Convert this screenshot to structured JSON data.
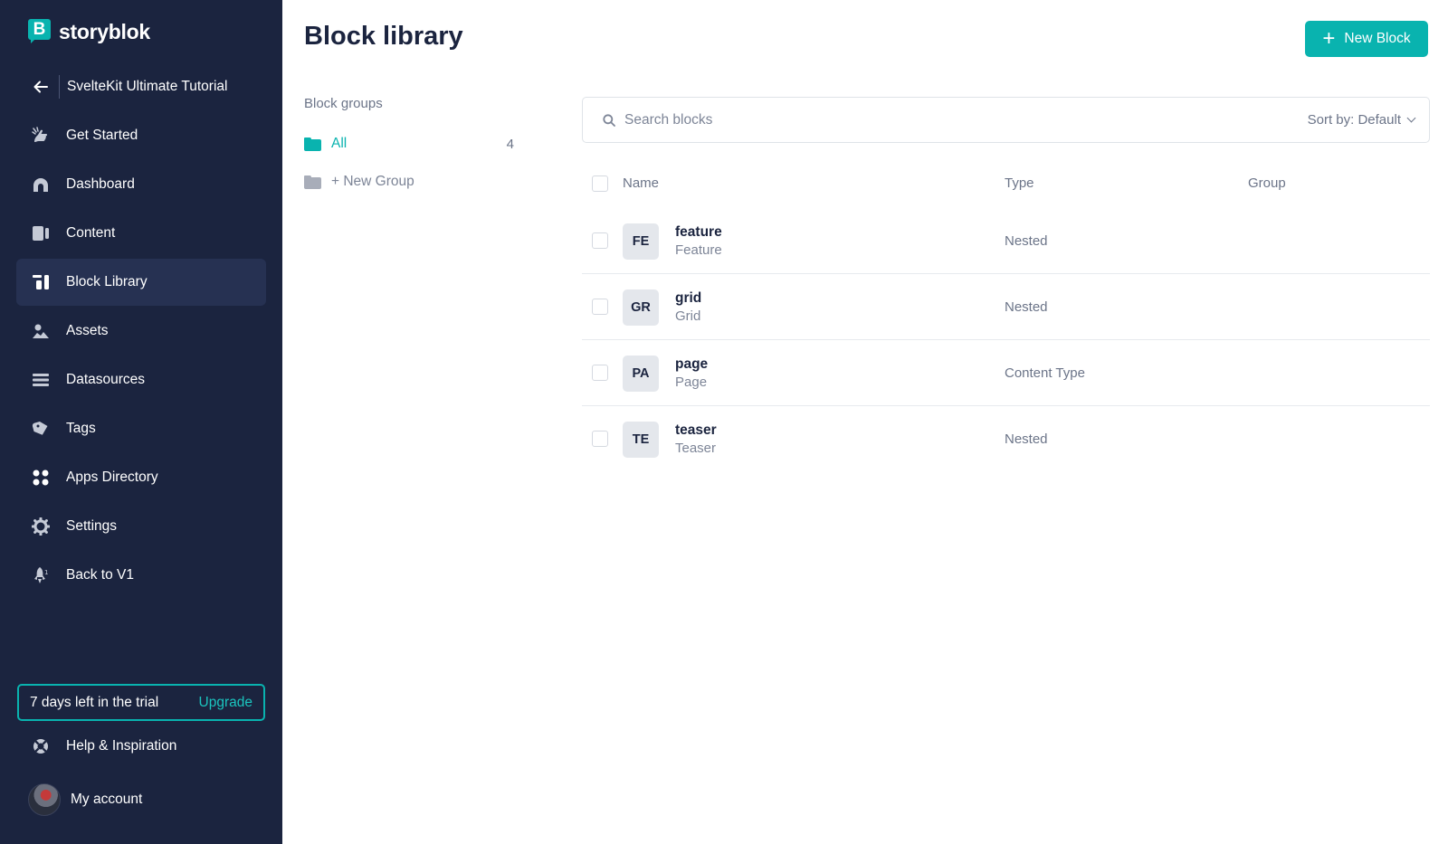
{
  "sidebar": {
    "brand": "storyblok",
    "space_name": "SvelteKit Ultimate Tutorial",
    "items": [
      {
        "label": "Get Started",
        "icon": "rocket-hand-icon"
      },
      {
        "label": "Dashboard",
        "icon": "dashboard-icon"
      },
      {
        "label": "Content",
        "icon": "content-icon"
      },
      {
        "label": "Block Library",
        "icon": "block-library-icon",
        "active": true
      },
      {
        "label": "Assets",
        "icon": "assets-icon"
      },
      {
        "label": "Datasources",
        "icon": "datasources-icon"
      },
      {
        "label": "Tags",
        "icon": "tag-icon"
      },
      {
        "label": "Apps Directory",
        "icon": "apps-icon"
      },
      {
        "label": "Settings",
        "icon": "gear-icon"
      },
      {
        "label": "Back to V1",
        "icon": "rocket-icon"
      }
    ],
    "trial": {
      "text": "7 days left in the trial",
      "upgrade": "Upgrade"
    },
    "help": "Help & Inspiration",
    "account": "My account"
  },
  "main": {
    "title": "Block library",
    "new_block_label": "New Block",
    "groups_title": "Block groups",
    "groups": [
      {
        "label": "All",
        "count": "4"
      },
      {
        "label": "+ New Group"
      }
    ],
    "search": {
      "placeholder": "Search blocks",
      "value": ""
    },
    "sort_label": "Sort by: Default",
    "columns": [
      "Name",
      "Type",
      "Group"
    ],
    "blocks": [
      {
        "badge": "FE",
        "name": "feature",
        "display": "Feature",
        "type": "Nested",
        "group": ""
      },
      {
        "badge": "GR",
        "name": "grid",
        "display": "Grid",
        "type": "Nested",
        "group": ""
      },
      {
        "badge": "PA",
        "name": "page",
        "display": "Page",
        "type": "Content Type",
        "group": ""
      },
      {
        "badge": "TE",
        "name": "teaser",
        "display": "Teaser",
        "type": "Nested",
        "group": ""
      }
    ]
  },
  "colors": {
    "sidebar_bg": "#1b243f",
    "accent": "#09b3af",
    "active_item": "#263152"
  }
}
